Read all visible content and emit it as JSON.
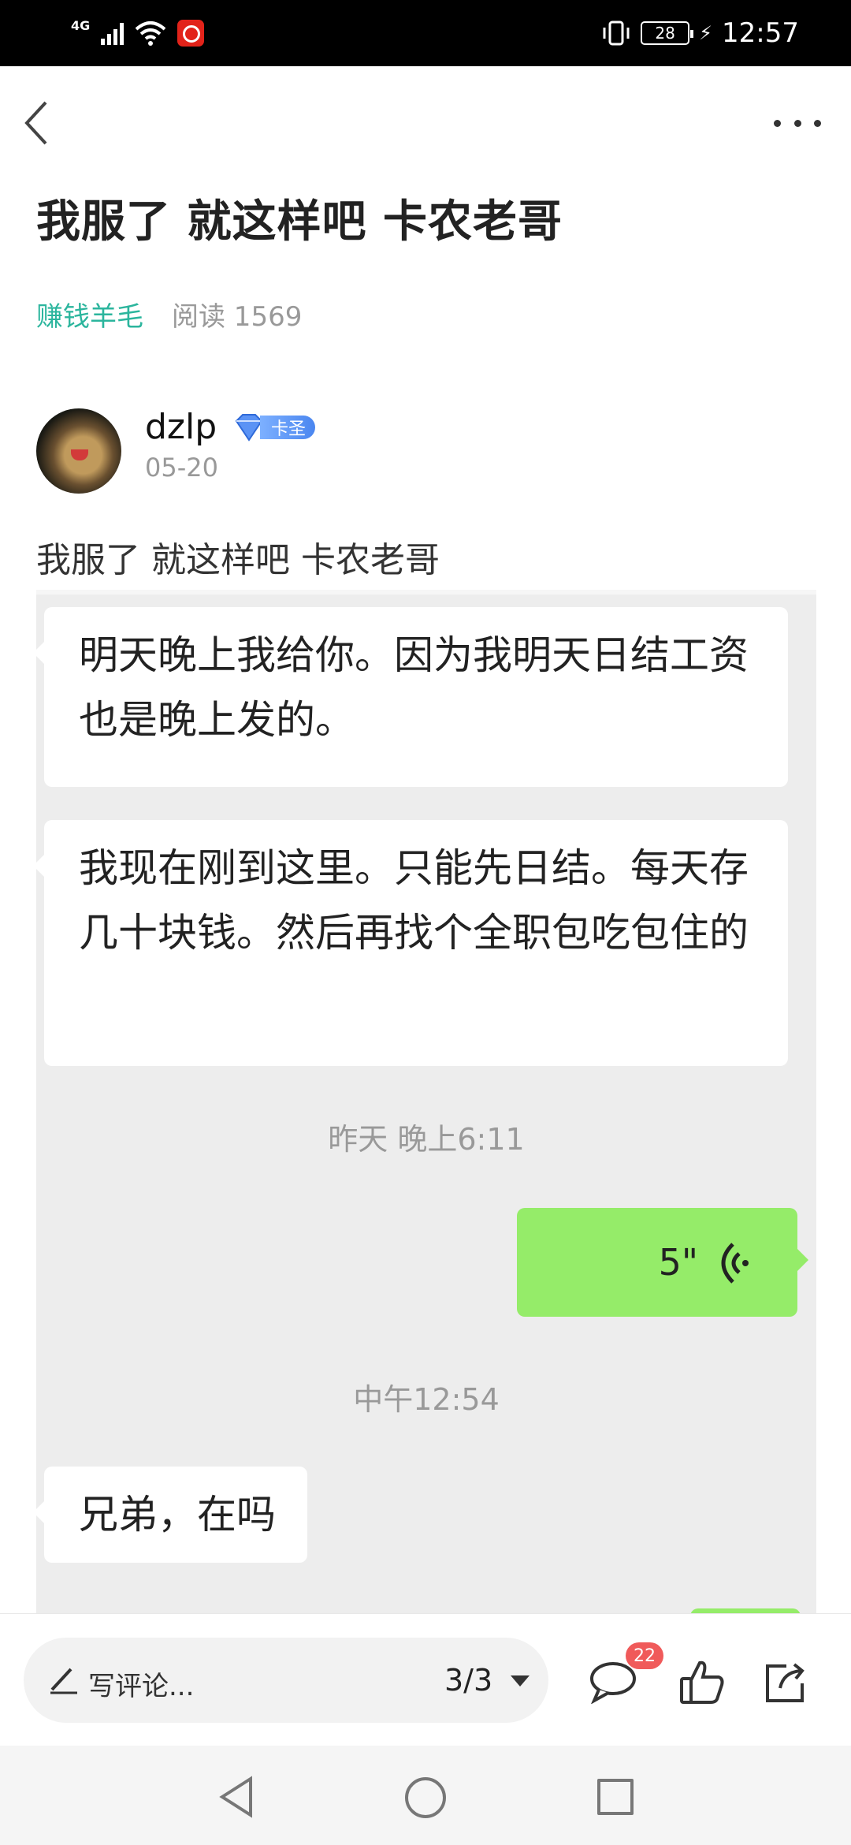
{
  "status_bar": {
    "network": "4G",
    "battery": "28",
    "time": "12:57"
  },
  "header": {
    "back_icon": "chevron-left-icon",
    "more_icon": "more-dots-icon"
  },
  "article": {
    "title": "我服了 就这样吧 卡农老哥",
    "category": "赚钱羊毛",
    "reads": "阅读 1569"
  },
  "author": {
    "name": "dzlp",
    "badge": "卡圣",
    "date": "05-20"
  },
  "post": {
    "text": "我服了 就这样吧  卡农老哥"
  },
  "chat": {
    "messages": [
      {
        "side": "left",
        "text": "明天晚上我给你。因为我明天日结工资也是晚上发的。"
      },
      {
        "side": "left",
        "text": "我现在刚到这里。只能先日结。每天存几十块钱。然后再找个全职包吃包住的"
      },
      {
        "side": "time",
        "text": "昨天 晚上6:11"
      },
      {
        "side": "right",
        "type": "voice",
        "text": "5\""
      },
      {
        "side": "time",
        "text": "中午12:54"
      },
      {
        "side": "left",
        "text": "兄弟，在吗"
      }
    ],
    "colors": {
      "background": "#ededed",
      "self_bubble": "#95ec69",
      "other_bubble": "#ffffff"
    }
  },
  "bottom_bar": {
    "comment_placeholder": "写评论...",
    "page": "3/3",
    "comment_count": "22"
  },
  "colors": {
    "accent": "#2bb59d",
    "badge_red": "#f05a5a"
  }
}
